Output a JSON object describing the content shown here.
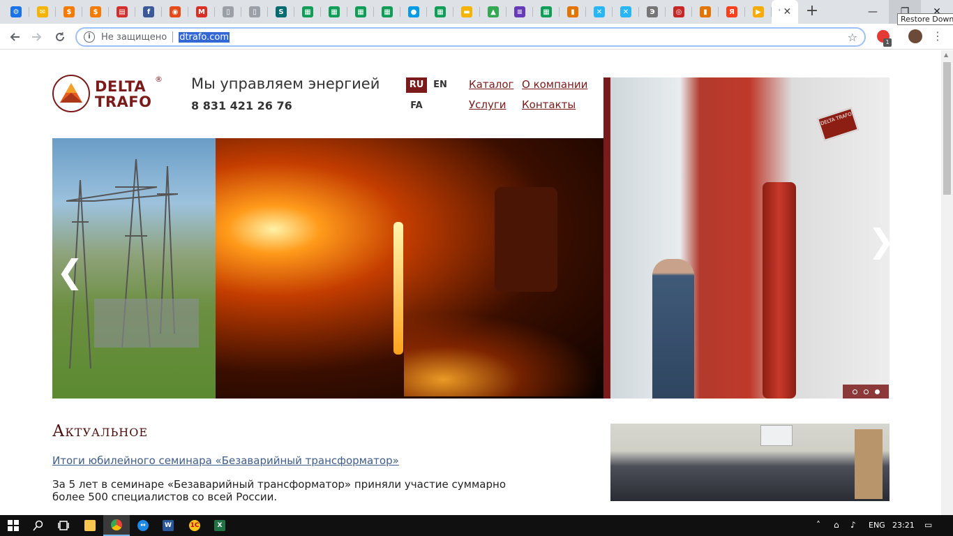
{
  "browser": {
    "tabs": [
      {
        "icon": "gear-icon",
        "color": "#1a73e8",
        "glyph": "⚙"
      },
      {
        "icon": "mail-icon",
        "color": "#f4b400",
        "glyph": "✉"
      },
      {
        "icon": "coin-icon",
        "color": "#f57c00",
        "glyph": "$"
      },
      {
        "icon": "coin-icon",
        "color": "#f57c00",
        "glyph": "$"
      },
      {
        "icon": "pdf-icon",
        "color": "#d32f2f",
        "glyph": "▤"
      },
      {
        "icon": "facebook-icon",
        "color": "#3b5998",
        "glyph": "f"
      },
      {
        "icon": "media-icon",
        "color": "#e64a19",
        "glyph": "◉"
      },
      {
        "icon": "gmail-icon",
        "color": "#d93025",
        "glyph": "M"
      },
      {
        "icon": "document-icon",
        "color": "#9aa0a6",
        "glyph": "▯"
      },
      {
        "icon": "document-icon",
        "color": "#9aa0a6",
        "glyph": "▯"
      },
      {
        "icon": "sharepoint-icon",
        "color": "#036c70",
        "glyph": "S"
      },
      {
        "icon": "sheets-icon",
        "color": "#0f9d58",
        "glyph": "▦"
      },
      {
        "icon": "sheets-icon",
        "color": "#0f9d58",
        "glyph": "▦"
      },
      {
        "icon": "sheets-icon",
        "color": "#0f9d58",
        "glyph": "▦"
      },
      {
        "icon": "sheets-icon",
        "color": "#0f9d58",
        "glyph": "▦"
      },
      {
        "icon": "circle-app-icon",
        "color": "#039be5",
        "glyph": "●"
      },
      {
        "icon": "sheets-icon",
        "color": "#0f9d58",
        "glyph": "▦"
      },
      {
        "icon": "slides-icon",
        "color": "#f4b400",
        "glyph": "▬"
      },
      {
        "icon": "drive-icon",
        "color": "#34a853",
        "glyph": "▲"
      },
      {
        "icon": "forms-icon",
        "color": "#673ab7",
        "glyph": "≡"
      },
      {
        "icon": "sheets-icon",
        "color": "#0f9d58",
        "glyph": "▦"
      },
      {
        "icon": "analytics-icon",
        "color": "#e37400",
        "glyph": "▮"
      },
      {
        "icon": "x-app-icon",
        "color": "#29b6f6",
        "glyph": "✕"
      },
      {
        "icon": "x-app-icon",
        "color": "#29b6f6",
        "glyph": "✕"
      },
      {
        "icon": "e-app-icon",
        "color": "#757575",
        "glyph": "Э"
      },
      {
        "icon": "red-logo-icon",
        "color": "#c62828",
        "glyph": "◎"
      },
      {
        "icon": "analytics-icon",
        "color": "#e37400",
        "glyph": "▮"
      },
      {
        "icon": "yandex-icon",
        "color": "#fc3f1d",
        "glyph": "Я"
      },
      {
        "icon": "play-icon",
        "color": "#f9ab00",
        "glyph": "▶"
      }
    ],
    "active_tab": {
      "title": "'",
      "close": "✕"
    },
    "new_tab": "+",
    "window": {
      "minimize": "—",
      "restore": "❐",
      "close": "✕",
      "tooltip": "Restore Down"
    },
    "security_text": "Не защищено",
    "url": "dtrafo.com",
    "extension_badge": "1"
  },
  "site": {
    "logo": {
      "line1": "DELTA",
      "line2": "TRAFO",
      "reg": "®"
    },
    "tagline": "Мы управляем энергией",
    "phone": "8 831 421 26 76",
    "languages": [
      {
        "code": "RU",
        "active": true
      },
      {
        "code": "EN",
        "active": false
      },
      {
        "code": "FA",
        "active": false
      }
    ],
    "nav": {
      "catalog": "Каталог",
      "about": "О компании",
      "services": "Услуги",
      "contacts": "Контакты"
    },
    "slider": {
      "prev": "❮",
      "next": "❯",
      "plate_text": "DELTA TRAFO",
      "dots": [
        false,
        false,
        true
      ]
    },
    "news": {
      "heading": "Актуальное",
      "link": "Итоги юбилейного семинара «Безаварийный трансформатор»",
      "text": "За 5 лет в семинаре «Безаварийный трансформатор» приняли участие суммарно более 500 специалистов со всей России."
    }
  },
  "taskbar": {
    "lang": "ENG",
    "time": "23:21"
  }
}
